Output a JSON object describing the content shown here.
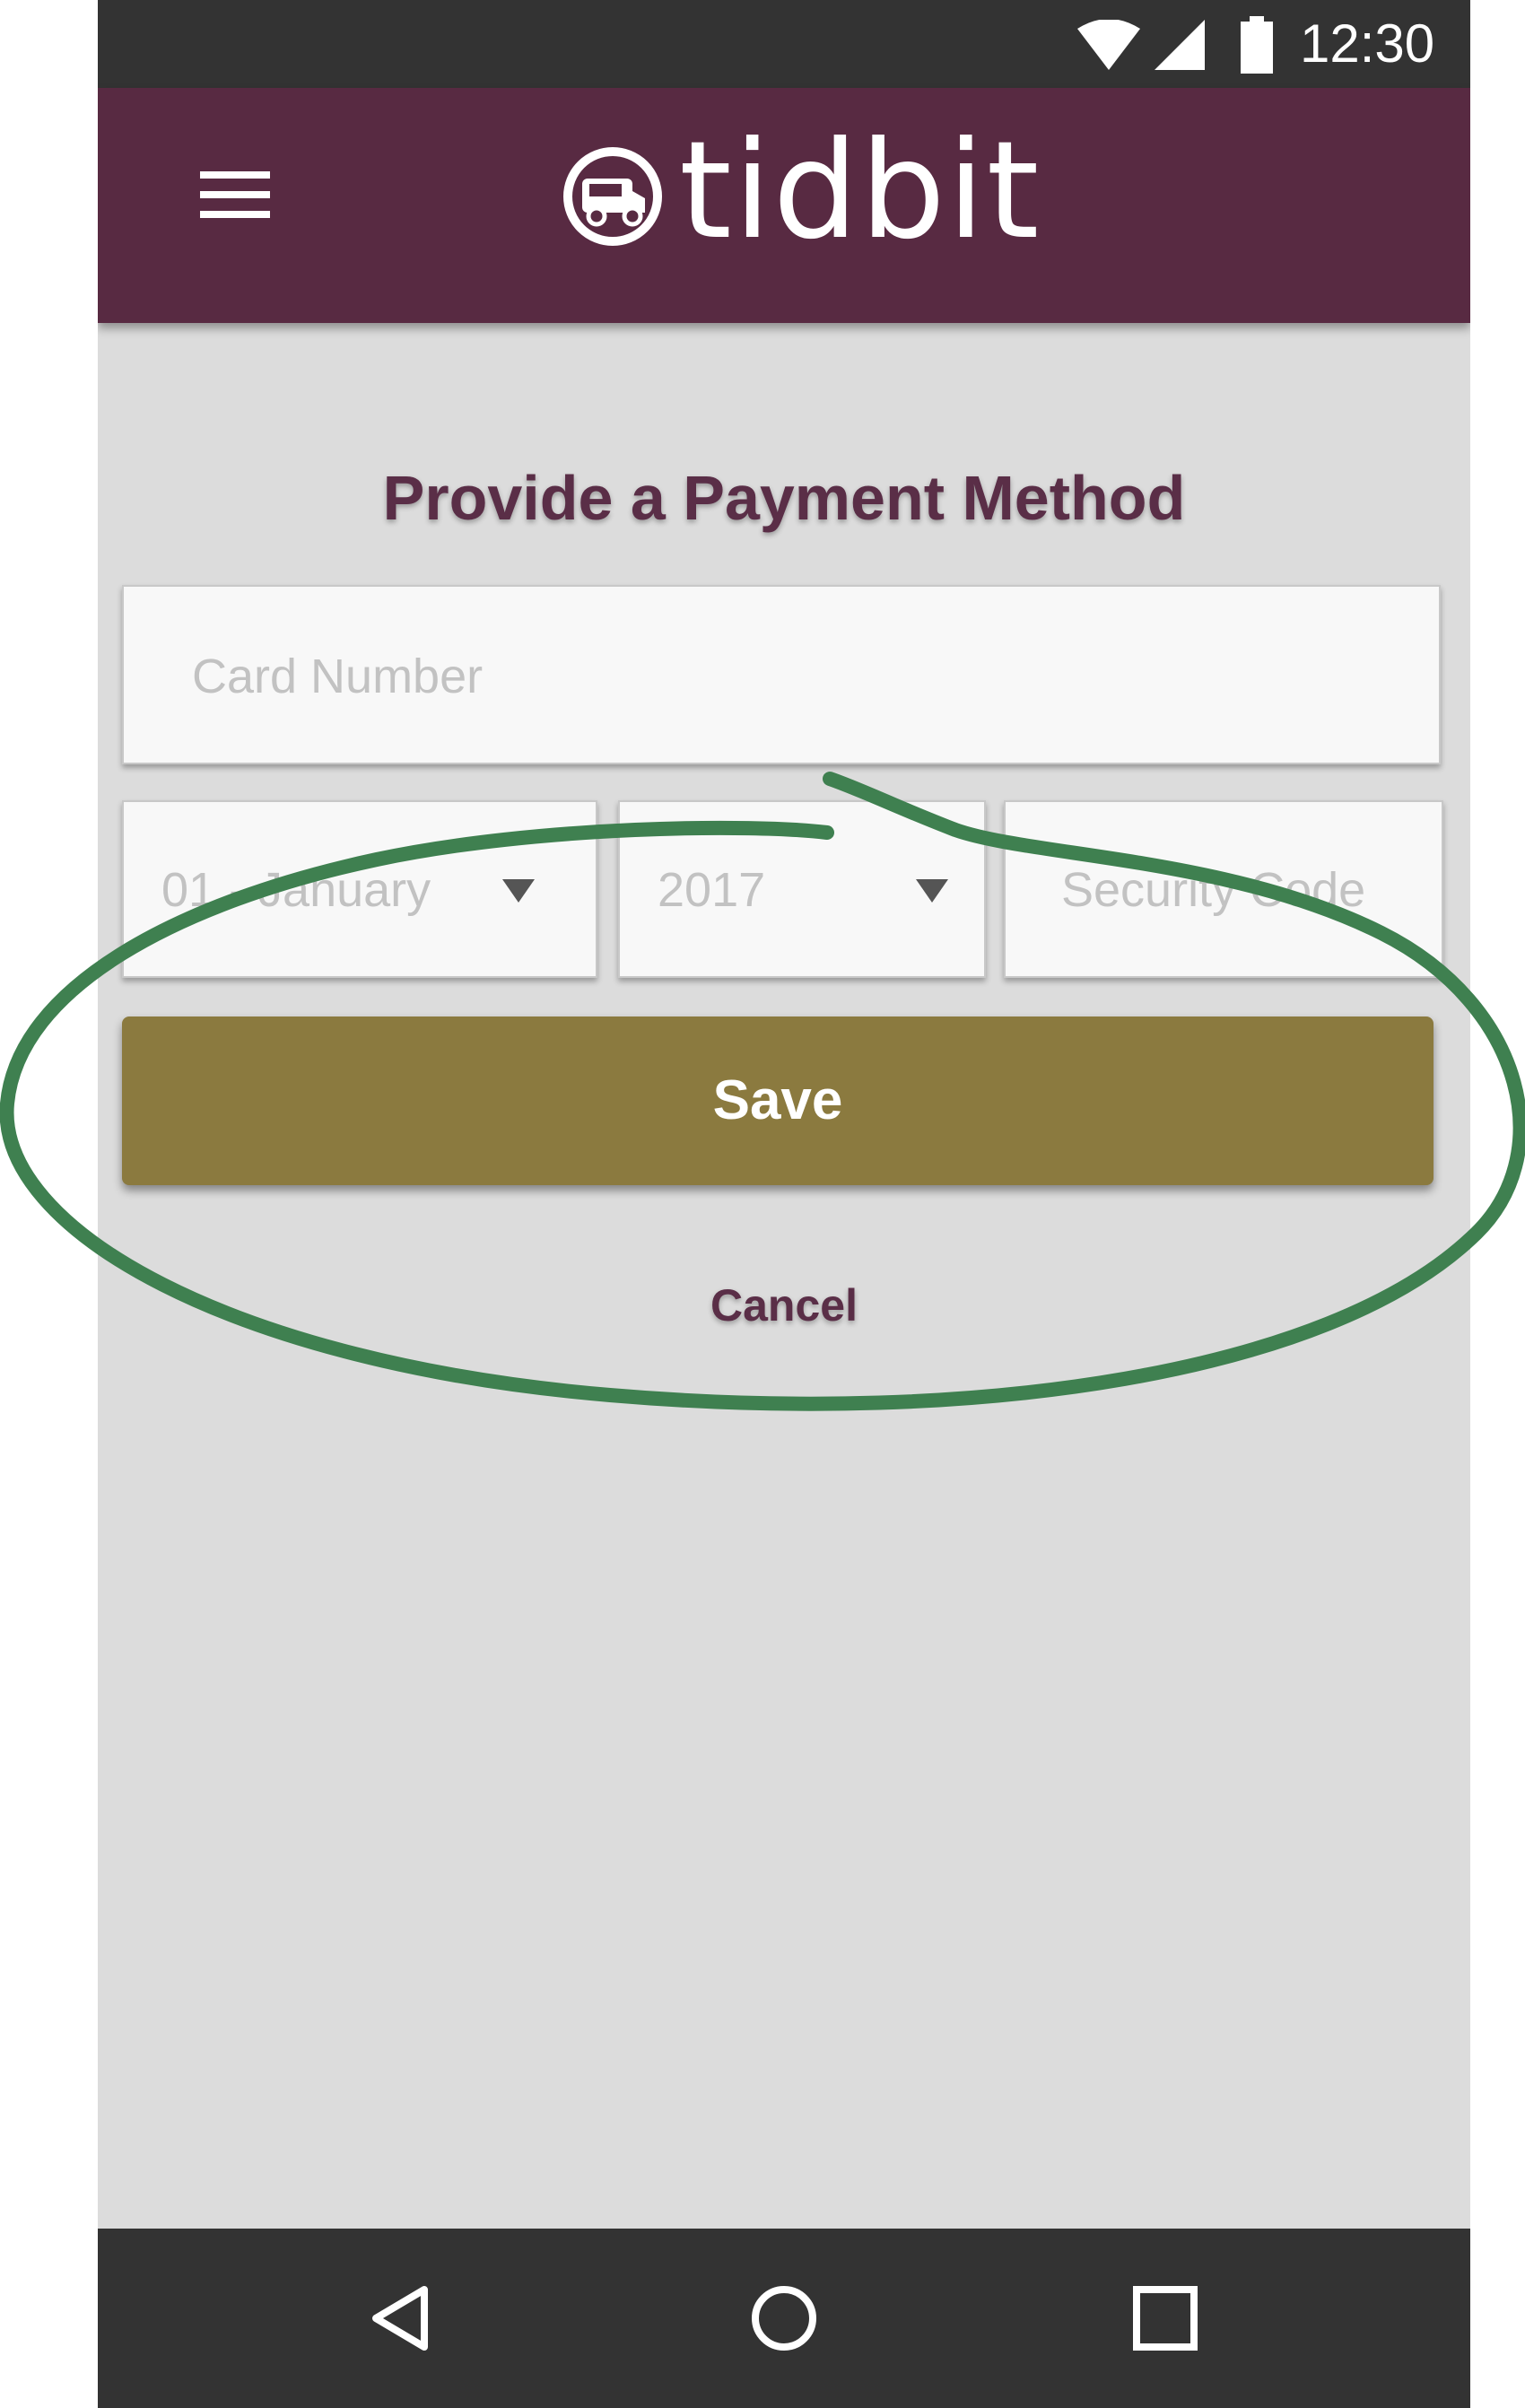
{
  "status_bar": {
    "time": "12:30"
  },
  "app_bar": {
    "logo_text": "tidbit",
    "menu_icon": "hamburger-menu-icon",
    "logo_icon": "food-truck-icon",
    "background_color": "#582a42"
  },
  "form": {
    "title": "Provide a Payment Method",
    "card_number": {
      "placeholder": "Card Number",
      "value": ""
    },
    "month": {
      "selected": "01 - January"
    },
    "year": {
      "selected": "2017"
    },
    "security_code": {
      "placeholder": "Security Code",
      "value": ""
    },
    "save_label": "Save",
    "cancel_label": "Cancel",
    "save_color": "#8b7a3f"
  },
  "nav_bar": {
    "back_icon": "back-triangle-icon",
    "home_icon": "home-circle-icon",
    "recent_icon": "recent-apps-square-icon"
  },
  "annotation": {
    "color": "#3f8050"
  }
}
